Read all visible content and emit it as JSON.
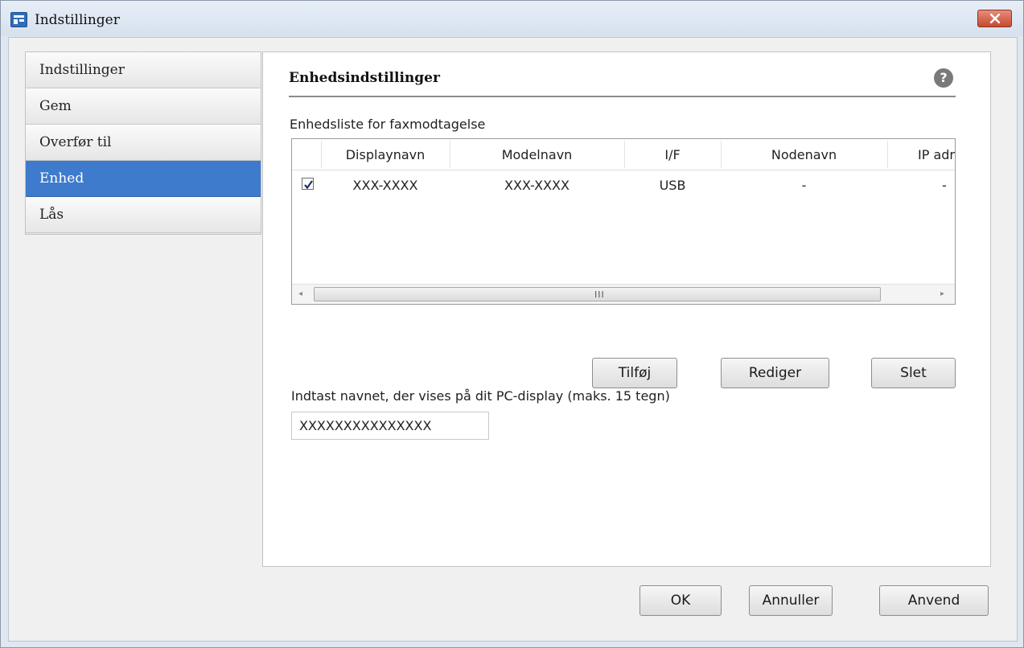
{
  "window": {
    "title": "Indstillinger"
  },
  "sidebar": {
    "items": [
      {
        "label": "Indstillinger",
        "active": false
      },
      {
        "label": "Gem",
        "active": false
      },
      {
        "label": "Overfør til",
        "active": false
      },
      {
        "label": "Enhed",
        "active": true
      },
      {
        "label": "Lås",
        "active": false
      }
    ]
  },
  "panel": {
    "title": "Enhedsindstillinger",
    "help_glyph": "?",
    "list_label": "Enhedsliste for faxmodtagelse",
    "table": {
      "columns": [
        "Displaynavn",
        "Modelnavn",
        "I/F",
        "Nodenavn",
        "IP adr"
      ],
      "rows": [
        {
          "checked": true,
          "cells": [
            "XXX-XXXX",
            "XXX-XXXX",
            "USB",
            "-",
            "-"
          ]
        }
      ],
      "scroll_grip": "III"
    },
    "buttons": {
      "add": "Tilføj",
      "edit": "Rediger",
      "delete": "Slet"
    },
    "name_label": "Indtast navnet, der vises på dit PC-display (maks. 15 tegn)",
    "name_value": "XXXXXXXXXXXXXXX"
  },
  "footer": {
    "ok": "OK",
    "cancel": "Annuller",
    "apply": "Anvend"
  },
  "colors": {
    "accent": "#3e7bcc",
    "close": "#c44a30",
    "window_frame": "#dfe7f1"
  }
}
